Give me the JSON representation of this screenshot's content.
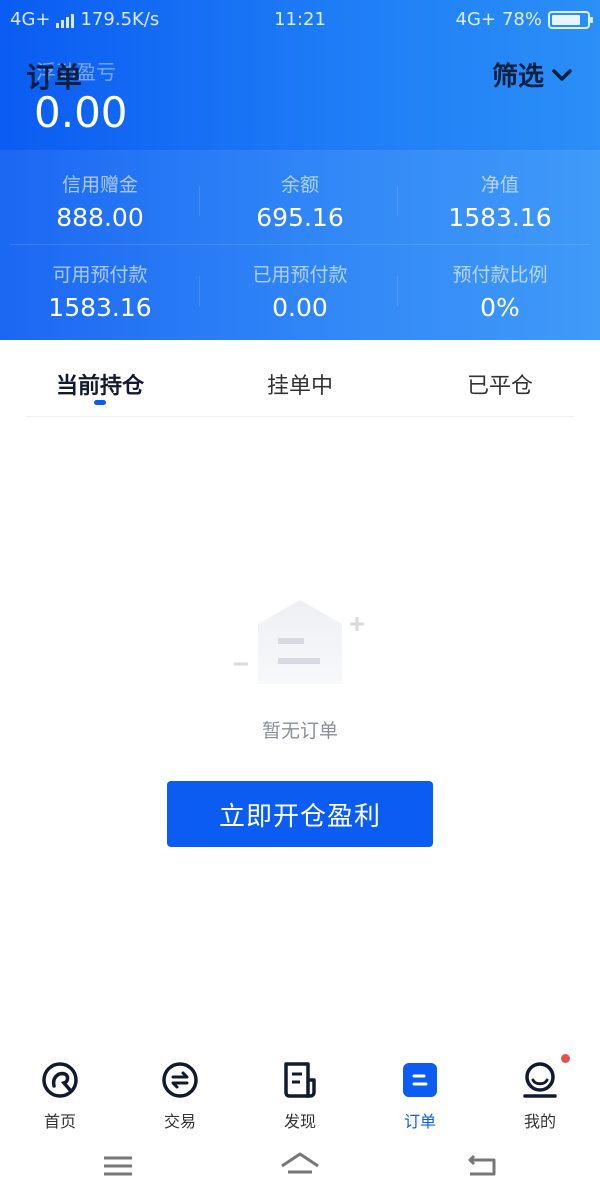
{
  "status_bar": {
    "left_network": "4G+",
    "speed": "179.5K/s",
    "time": "11:21",
    "right_network": "4G+",
    "battery": "78%"
  },
  "header": {
    "title": "订单",
    "subtitle_ghost": "浮动盈亏",
    "pnl_value": "0.00",
    "filter_label": "筛选"
  },
  "stats": {
    "row1": [
      {
        "label": "信用赠金",
        "value": "888.00"
      },
      {
        "label": "余额",
        "value": "695.16"
      },
      {
        "label": "净值",
        "value": "1583.16"
      }
    ],
    "row2": [
      {
        "label": "可用预付款",
        "value": "1583.16"
      },
      {
        "label": "已用预付款",
        "value": "0.00"
      },
      {
        "label": "预付款比例",
        "value": "0%"
      }
    ]
  },
  "tabs": [
    {
      "label": "当前持仓",
      "active": true
    },
    {
      "label": "挂单中",
      "active": false
    },
    {
      "label": "已平仓",
      "active": false
    }
  ],
  "empty_state": {
    "icon": "empty-box-icon",
    "text": "暂无订单",
    "cta_label": "立即开仓盈利"
  },
  "bottom_nav": [
    {
      "label": "首页",
      "icon": "home-icon",
      "active": false
    },
    {
      "label": "交易",
      "icon": "exchange-icon",
      "active": false
    },
    {
      "label": "发现",
      "icon": "discover-icon",
      "active": false
    },
    {
      "label": "订单",
      "icon": "orders-icon",
      "active": true
    },
    {
      "label": "我的",
      "icon": "profile-icon",
      "active": false,
      "badge": true
    }
  ],
  "colors": {
    "accent": "#0a5cf2",
    "header_gradient_start": "#0a5cf2",
    "header_gradient_end": "#2a8ff7",
    "badge": "#e0524f"
  }
}
